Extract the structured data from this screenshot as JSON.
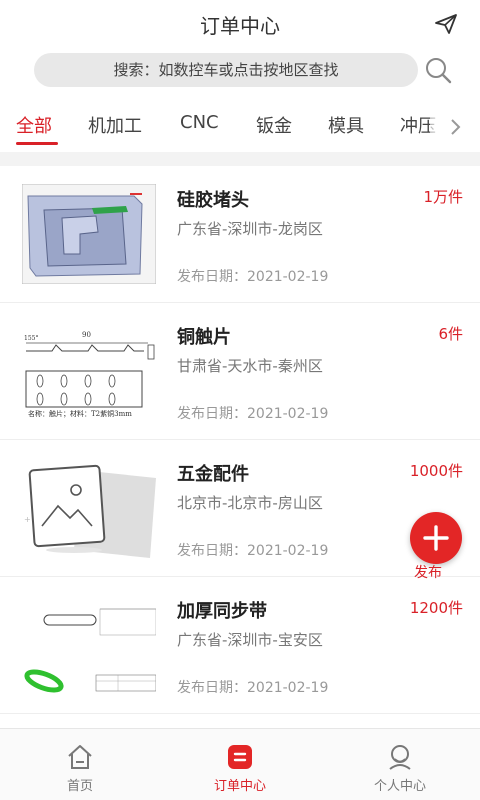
{
  "header": {
    "title": "订单中心"
  },
  "search": {
    "placeholder": "搜索：如数控车或点击按地区查找"
  },
  "tabs": [
    {
      "label": "全部",
      "active": true
    },
    {
      "label": "机加工"
    },
    {
      "label": "CNC"
    },
    {
      "label": "钣金"
    },
    {
      "label": "模具"
    },
    {
      "label": "冲压"
    }
  ],
  "orders": [
    {
      "title": "硅胶堵头",
      "quantity": "1万件",
      "location": "广东省-深圳市-龙岗区",
      "date": "发布日期：2021-02-19"
    },
    {
      "title": "铜触片",
      "quantity": "6件",
      "location": "甘肃省-天水市-秦州区",
      "date": "发布日期：2021-02-19",
      "drawing_text": [
        "90",
        "155°",
        "名称：触片；材料：T2紫铜3mm"
      ]
    },
    {
      "title": "五金配件",
      "quantity": "1000件",
      "location": "北京市-北京市-房山区",
      "date": "发布日期：2021-02-19"
    },
    {
      "title": "加厚同步带",
      "quantity": "1200件",
      "location": "广东省-深圳市-宝安区",
      "date": "发布日期：2021-02-19"
    }
  ],
  "fab": {
    "label": "发布"
  },
  "nav": [
    {
      "label": "首页"
    },
    {
      "label": "订单中心",
      "active": true
    },
    {
      "label": "个人中心"
    }
  ],
  "colors": {
    "accent": "#d92128",
    "search_bg": "#e8e8e8",
    "band": "#f3f3f3"
  }
}
